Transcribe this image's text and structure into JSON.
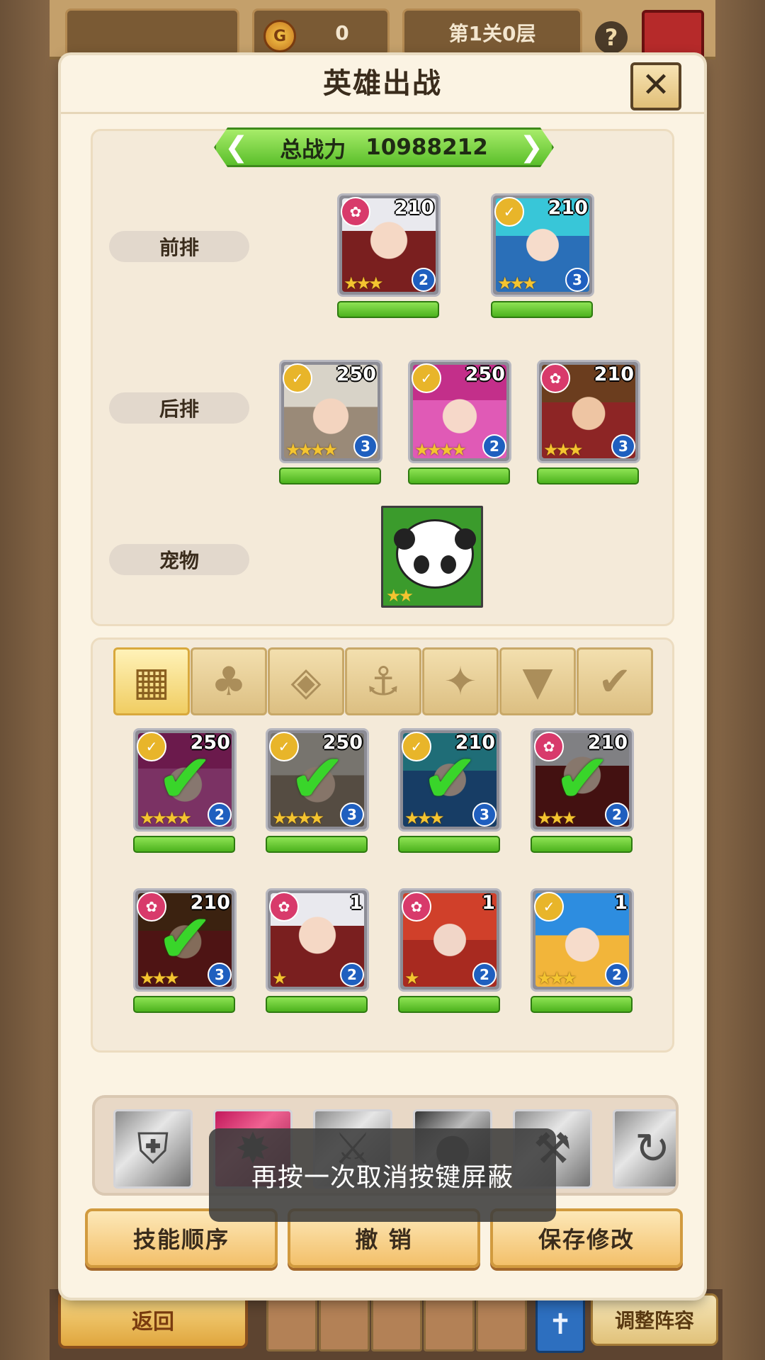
{
  "background": {
    "coins": "0",
    "stage": "第1关0层",
    "help_glyph": "?",
    "return_label": "返回",
    "adjust_label": "调整阵容"
  },
  "modal": {
    "title": "英雄出战",
    "close_glyph": "✕",
    "power_label": "总战力",
    "power_value": "10988212"
  },
  "formation": {
    "front_label": "前排",
    "back_label": "后排",
    "pet_label": "宠物",
    "front": [
      {
        "level": "210",
        "element": "pink",
        "stars": "★★★",
        "rank": "2",
        "art": "a-white"
      },
      {
        "level": "210",
        "element": "gold",
        "stars": "★★★",
        "rank": "3",
        "art": "a-blue"
      }
    ],
    "back": [
      {
        "level": "250",
        "element": "gold",
        "stars": "★★★★",
        "rank": "3",
        "art": "a-silver"
      },
      {
        "level": "250",
        "element": "gold",
        "stars": "★★★★",
        "rank": "2",
        "art": "a-pink"
      },
      {
        "level": "210",
        "element": "pink",
        "stars": "★★★",
        "rank": "3",
        "art": "a-brown"
      }
    ],
    "pet_stars": "★★"
  },
  "filter_tabs": [
    {
      "name": "all",
      "glyph": "▦"
    },
    {
      "name": "class-1",
      "glyph": "♣"
    },
    {
      "name": "class-2",
      "glyph": "◈"
    },
    {
      "name": "class-3",
      "glyph": "⚓"
    },
    {
      "name": "class-4",
      "glyph": "✦"
    },
    {
      "name": "class-5",
      "glyph": "▼"
    },
    {
      "name": "class-6",
      "glyph": "✔"
    }
  ],
  "roster": [
    {
      "level": "250",
      "element": "gold",
      "stars": "★★★★",
      "rank": "2",
      "art": "a-pink",
      "selected": true
    },
    {
      "level": "250",
      "element": "gold",
      "stars": "★★★★",
      "rank": "3",
      "art": "a-silver",
      "selected": true
    },
    {
      "level": "210",
      "element": "gold",
      "stars": "★★★",
      "rank": "3",
      "art": "a-blue",
      "selected": true
    },
    {
      "level": "210",
      "element": "pink",
      "stars": "★★★",
      "rank": "2",
      "art": "a-white",
      "selected": true
    },
    {
      "level": "210",
      "element": "pink",
      "stars": "★★★",
      "rank": "3",
      "art": "a-brown",
      "selected": true
    },
    {
      "level": "1",
      "element": "pink",
      "stars": "★",
      "rank": "2",
      "art": "a-white",
      "selected": false
    },
    {
      "level": "1",
      "element": "pink",
      "stars": "★",
      "rank": "2",
      "art": "a-red",
      "selected": false
    },
    {
      "level": "1",
      "element": "gold",
      "stars": "★★★",
      "rank": "2",
      "art": "a-sky",
      "selected": false
    }
  ],
  "skills": [
    "shield-skill-icon",
    "pink-skill-icon",
    "slash-skill-icon",
    "dark-skill-icon",
    "hammer-skill-icon",
    "swirl-skill-icon"
  ],
  "actions": {
    "skill_order": "技能顺序",
    "undo": "撤 销",
    "save": "保存修改"
  },
  "toast": "再按一次取消按键屏蔽"
}
